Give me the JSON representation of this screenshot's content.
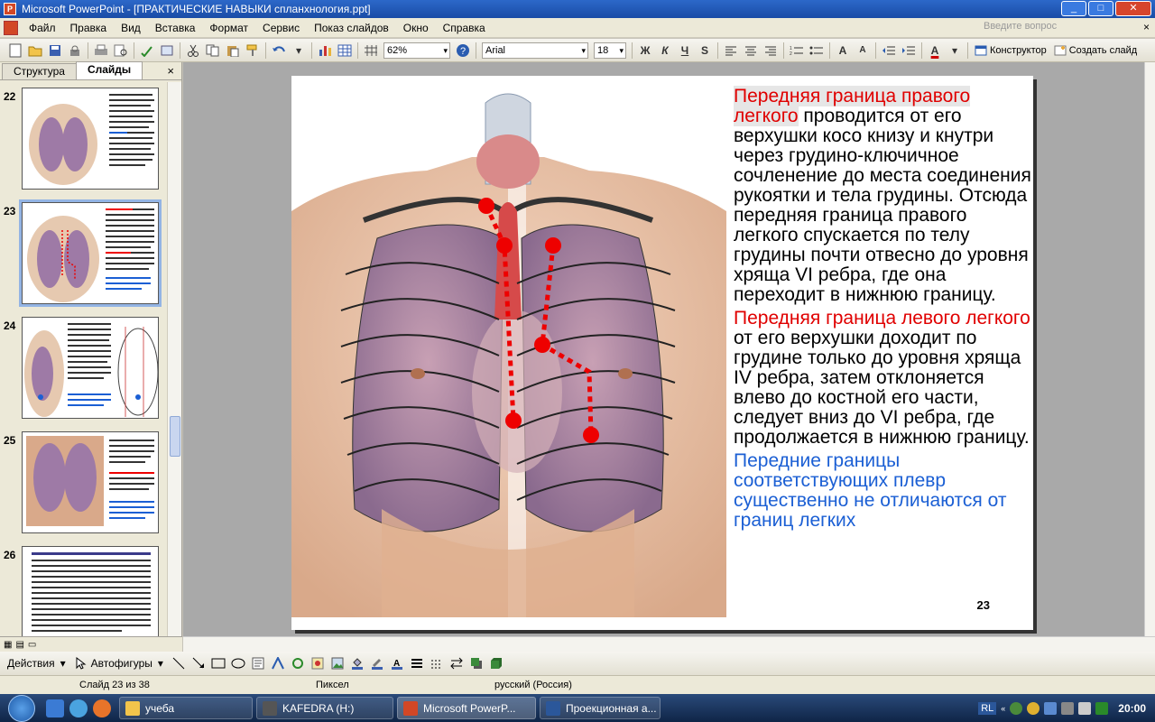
{
  "window": {
    "title": "Microsoft PowerPoint - [ПРАКТИЧЕСКИЕ НАВЫКИ спланхнология.ppt]",
    "app_icon": "P",
    "btn_min": "_",
    "btn_max": "□",
    "btn_close": "✕"
  },
  "menu": {
    "items": [
      "Файл",
      "Правка",
      "Вид",
      "Вставка",
      "Формат",
      "Сервис",
      "Показ слайдов",
      "Окно",
      "Справка"
    ],
    "ask_placeholder": "Введите вопрос",
    "close": "×"
  },
  "toolbar": {
    "zoom": "62%",
    "font": "Arial",
    "size": "18",
    "bold": "Ж",
    "italic": "К",
    "underline": "Ч",
    "shadow": "S",
    "font_grow": "A",
    "font_shrink": "A",
    "font_color": "A",
    "designer": "Конструктор",
    "new_slide": "Создать слайд"
  },
  "panel": {
    "tab_outline": "Структура",
    "tab_slides": "Слайды",
    "close": "×",
    "thumb_numbers": [
      "22",
      "23",
      "24",
      "25",
      "26"
    ],
    "active_index": 1
  },
  "slide": {
    "p1_red": "Передняя граница правого легкого",
    "p1_rest": " проводится от его верхушки косо книзу и кнутри через грудино-ключичное сочленение до места соединения рукоятки и тела грудины. Отсюда передняя граница правого легкого спускается по телу грудины почти отвесно до уровня хряща VI ребра, где она переходит в нижнюю границу.",
    "p2_red": "Передняя граница левого легкого",
    "p2_rest": " от его верхушки доходит по грудине только до уровня хряща IV ребра, затем отклоняется влево до костной его части, следует вниз до VI ребра, где продолжается в нижнюю границу.",
    "p3_blue": "Передние границы соответствующих плевр существенно не отличаются от границ легких",
    "number": "23"
  },
  "drawbar": {
    "actions": "Действия",
    "autoshapes": "Автофигуры"
  },
  "status": {
    "slide": "Слайд 23 из 38",
    "design": "Пиксел",
    "lang": "русский (Россия)"
  },
  "taskbar": {
    "tasks": [
      "учеба",
      "KAFEDRA (H:)",
      "Microsoft PowerP...",
      "Проекционная а..."
    ],
    "lang": "RL",
    "clock": "20:00"
  },
  "colors": {
    "accent_red": "#e00000",
    "accent_blue": "#1b5fd4",
    "title_blue": "#1a4ca6"
  }
}
